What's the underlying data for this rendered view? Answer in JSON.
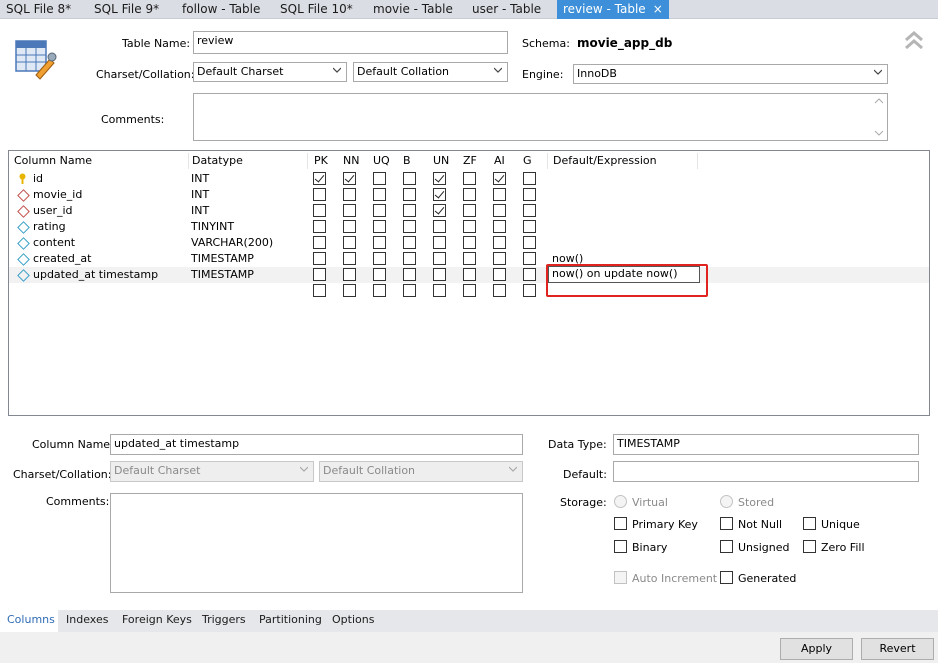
{
  "tabs": [
    {
      "label": "SQL File 8*"
    },
    {
      "label": "SQL File 9*"
    },
    {
      "label": "follow - Table"
    },
    {
      "label": "SQL File 10*"
    },
    {
      "label": "movie - Table"
    },
    {
      "label": "user - Table"
    },
    {
      "label": "review - Table",
      "active": true
    }
  ],
  "tab_close_glyph": "×",
  "table_editor": {
    "table_name_label": "Table Name:",
    "table_name_value": "review",
    "schema_label": "Schema:",
    "schema_value": "movie_app_db",
    "charset_label": "Charset/Collation:",
    "charset_value": "Default Charset",
    "collation_value": "Default Collation",
    "engine_label": "Engine:",
    "engine_value": "InnoDB",
    "comments_label": "Comments:",
    "comments_value": ""
  },
  "columns_grid": {
    "headers": [
      "Column Name",
      "Datatype",
      "PK",
      "NN",
      "UQ",
      "B",
      "UN",
      "ZF",
      "AI",
      "G",
      "Default/Expression"
    ],
    "rows": [
      {
        "icon": "key",
        "name": "id",
        "datatype": "INT",
        "flags": [
          true,
          true,
          false,
          false,
          true,
          false,
          true,
          false
        ],
        "default": ""
      },
      {
        "icon": "fk-diamond",
        "name": "movie_id",
        "datatype": "INT",
        "flags": [
          false,
          false,
          false,
          false,
          true,
          false,
          false,
          false
        ],
        "default": ""
      },
      {
        "icon": "fk-diamond",
        "name": "user_id",
        "datatype": "INT",
        "flags": [
          false,
          false,
          false,
          false,
          true,
          false,
          false,
          false
        ],
        "default": ""
      },
      {
        "icon": "diamond",
        "name": "rating",
        "datatype": "TINYINT",
        "flags": [
          false,
          false,
          false,
          false,
          false,
          false,
          false,
          false
        ],
        "default": ""
      },
      {
        "icon": "diamond",
        "name": "content",
        "datatype": "VARCHAR(200)",
        "flags": [
          false,
          false,
          false,
          false,
          false,
          false,
          false,
          false
        ],
        "default": ""
      },
      {
        "icon": "diamond",
        "name": "created_at",
        "datatype": "TIMESTAMP",
        "flags": [
          false,
          false,
          false,
          false,
          false,
          false,
          false,
          false
        ],
        "default": "now()"
      },
      {
        "icon": "diamond",
        "name": "updated_at timestamp",
        "datatype": "TIMESTAMP",
        "flags": [
          false,
          false,
          false,
          false,
          false,
          false,
          false,
          false
        ],
        "default": "now() on update now()",
        "editing": true
      },
      {
        "icon": "",
        "name": "",
        "datatype": "",
        "flags": [
          false,
          false,
          false,
          false,
          false,
          false,
          false,
          false
        ],
        "default": ""
      }
    ]
  },
  "column_details": {
    "column_name_label": "Column Name:",
    "column_name_value": "updated_at timestamp",
    "charset_label": "Charset/Collation:",
    "charset_value": "Default Charset",
    "collation_value": "Default Collation",
    "comments_label": "Comments:",
    "data_type_label": "Data Type:",
    "data_type_value": "TIMESTAMP",
    "default_label": "Default:",
    "default_value": "",
    "storage_label": "Storage:",
    "virtual_label": "Virtual",
    "stored_label": "Stored",
    "primary_key_label": "Primary Key",
    "not_null_label": "Not Null",
    "unique_label": "Unique",
    "binary_label": "Binary",
    "unsigned_label": "Unsigned",
    "zero_fill_label": "Zero Fill",
    "auto_increment_label": "Auto Increment",
    "generated_label": "Generated"
  },
  "bottom_tabs": [
    {
      "label": "Columns",
      "active": true
    },
    {
      "label": "Indexes"
    },
    {
      "label": "Foreign Keys"
    },
    {
      "label": "Triggers"
    },
    {
      "label": "Partitioning"
    },
    {
      "label": "Options"
    }
  ],
  "buttons": {
    "apply": "Apply",
    "revert": "Revert"
  },
  "colors": {
    "active_tab": "#3c8fd8",
    "highlight_box": "#e0231e",
    "key_icon": "#e8b400",
    "fk_icon": "#c0504d",
    "col_icon": "#3aa0c8"
  }
}
